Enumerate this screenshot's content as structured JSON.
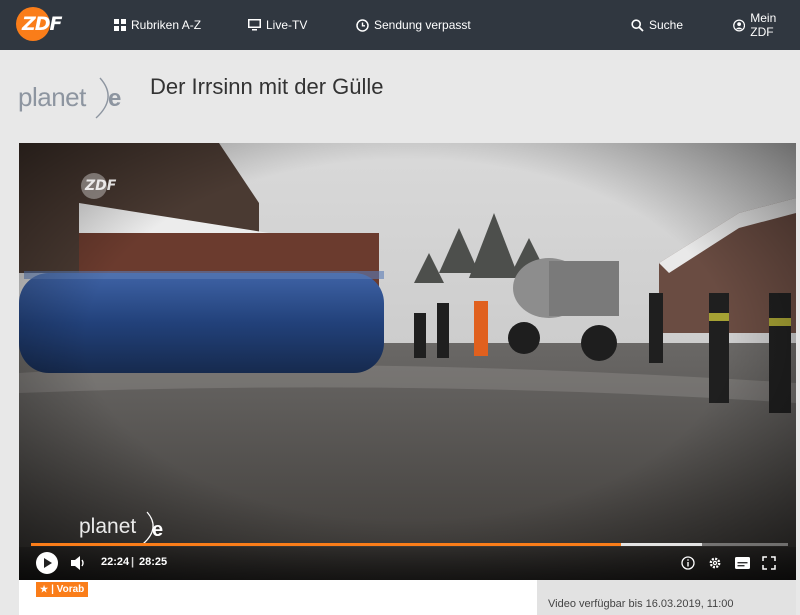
{
  "nav": {
    "logo_text": "ZDF",
    "items": [
      {
        "label": "Rubriken A-Z",
        "icon": "grid-icon"
      },
      {
        "label": "Live-TV",
        "icon": "tv-icon"
      },
      {
        "label": "Sendung verpasst",
        "icon": "clock-icon"
      },
      {
        "label": "Suche",
        "icon": "search-icon"
      },
      {
        "label": "Mein ZDF",
        "icon": "user-icon"
      }
    ]
  },
  "header": {
    "brand": "planet",
    "brand_letter": "e",
    "title": "Der Irrsinn mit der Gülle"
  },
  "video": {
    "watermark_top": "ZDF",
    "watermark_bottom": "planet",
    "watermark_bottom_letter": "e",
    "current_time": "22:24",
    "separator": "|",
    "duration": "28:25",
    "progress_fraction": 0.779,
    "buffered_fraction": 0.886
  },
  "meta": {
    "badge_star": "★",
    "badge_label": "| Vorab",
    "availability": "Video verfügbar bis 16.03.2019, 11:00"
  },
  "colors": {
    "accent": "#fa7d19",
    "nav_bg": "#303740",
    "page_bg": "#e8e8e8"
  }
}
